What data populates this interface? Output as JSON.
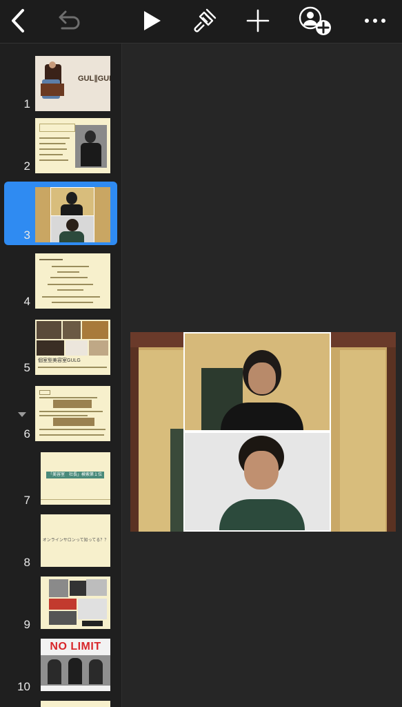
{
  "toolbar": {
    "back_icon": "chevron-left-icon",
    "undo_icon": "undo-icon",
    "play_icon": "play-icon",
    "format_icon": "paintbrush-icon",
    "add_icon": "plus-icon",
    "collaborate_icon": "add-person-icon",
    "more_icon": "ellipsis-icon"
  },
  "slides": [
    {
      "number": "1",
      "brand": "GUL∥GUL"
    },
    {
      "number": "2"
    },
    {
      "number": "3",
      "selected": true
    },
    {
      "number": "4"
    },
    {
      "number": "5",
      "caption": "個室型美容室GULGUL"
    },
    {
      "number": "6",
      "collapse_icon": "disclosure-triangle-icon"
    },
    {
      "number": "7",
      "caption": "「美容室　社長」検索第１位"
    },
    {
      "number": "8",
      "caption": "オンラインサロンって知ってる？？"
    },
    {
      "number": "9"
    },
    {
      "number": "10",
      "caption": "NO LIMIT"
    }
  ],
  "colors": {
    "selection": "#2f8bf2",
    "thumb_bg": "#f7f0cc",
    "toolbar_bg": "#1c1c1c"
  }
}
